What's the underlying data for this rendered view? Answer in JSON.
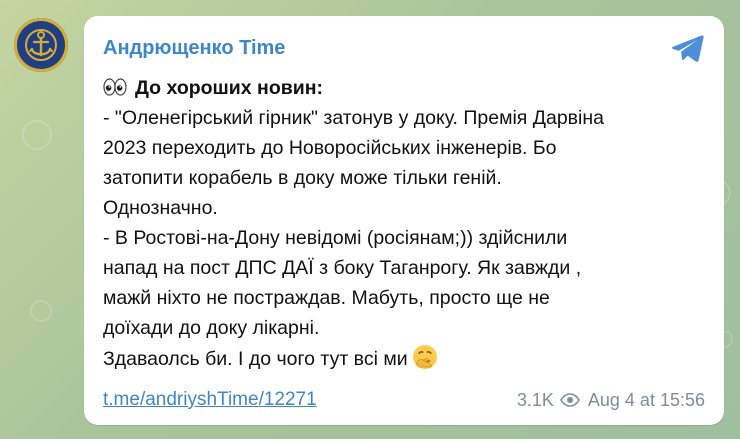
{
  "channel": {
    "name": "Андрющенко Time",
    "accent_color": "#3f86c4",
    "avatar_icon": "anchor-emblem-icon",
    "share_icon": "telegram-share-icon"
  },
  "post": {
    "heading": "До хороших новин:",
    "heading_icon": "eyes-icon",
    "lines": [
      "- \"Оленегірський гірник\" затонув у доку. Премія Дарвіна",
      "2023 переходить до Новоросійських інженерів. Бо",
      "затопити корабель в доку може тільки геній.",
      "Однозначно.",
      "- В Ростові-на-Дону невідомі (росіянам;)) здійснили",
      "напад на пост ДПС ДАЇ з боку Таганрогу. Як завжди ,",
      "мажй ніхто не постраждав. Мабуть, просто ще не",
      "доїхади до доку лікарні.",
      "Здаваолсь би. І до чого тут всі ми"
    ],
    "closing_icon": "face-with-hand-over-mouth-icon"
  },
  "footer": {
    "link": "t.me/andriyshTime/12271",
    "views": "3.1K",
    "views_icon": "eye-icon",
    "date": "Aug 4 at 15:56"
  }
}
